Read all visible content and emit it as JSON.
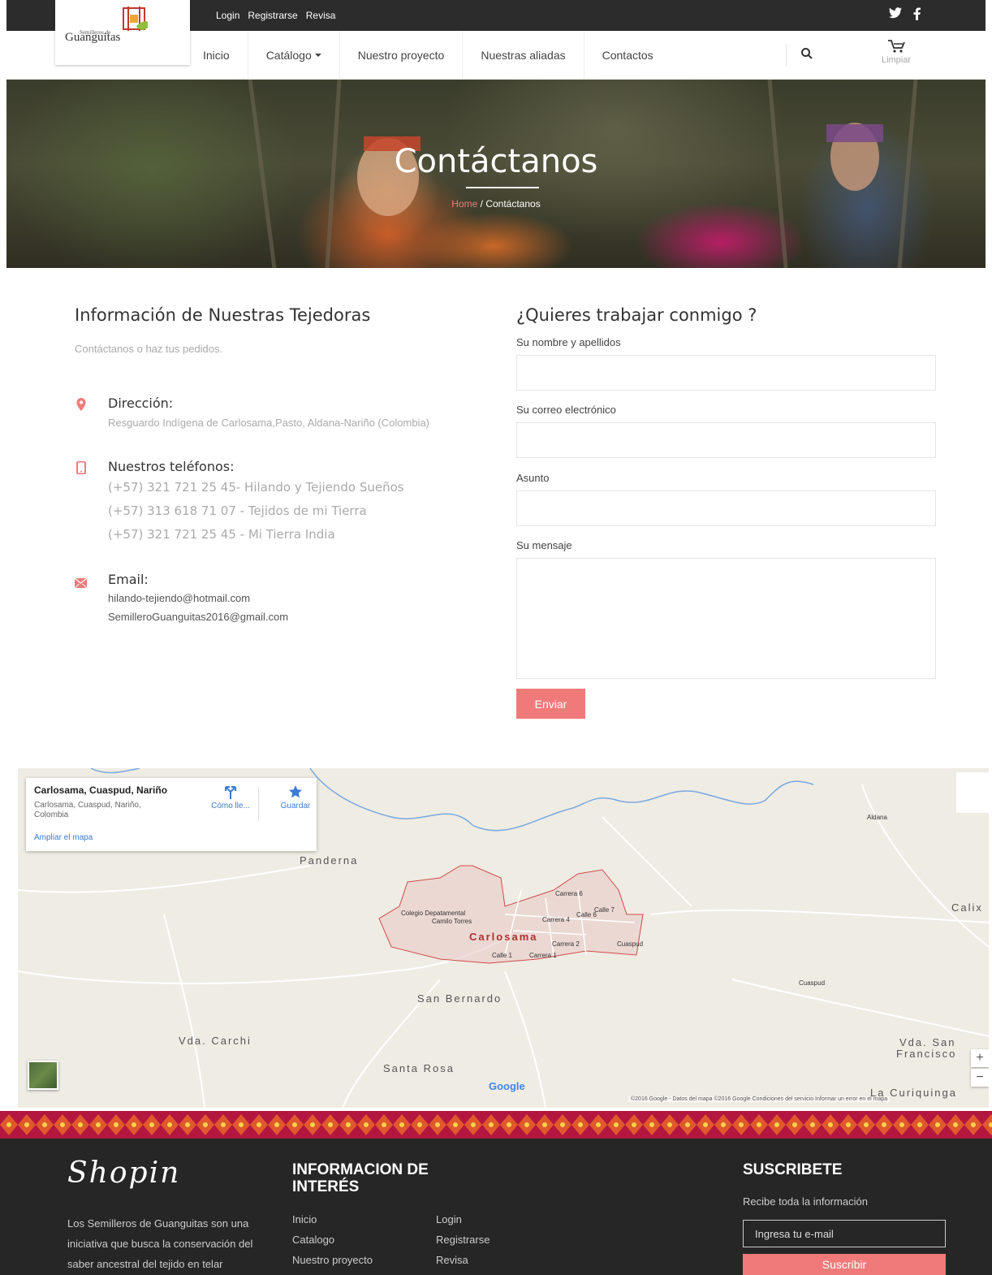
{
  "topbar": {
    "links": [
      "Login",
      "Registrarse",
      "Revisa"
    ],
    "social": [
      "twitter-icon",
      "facebook-icon"
    ]
  },
  "logo": {
    "tagline": "Semilleros de",
    "name": "Guanguitas"
  },
  "nav": {
    "items": [
      "Inicio",
      "Catálogo",
      "Nuestro proyecto",
      "Nuestras aliadas",
      "Contactos"
    ],
    "cart_label": "Limpiar"
  },
  "hero": {
    "title": "Contáctanos",
    "crumb_home": "Home",
    "crumb_sep": "/",
    "crumb_current": "Contáctanos"
  },
  "info": {
    "title": "Información de Nuestras Tejedoras",
    "subtitle": "Contáctanos o haz tus pedidos.",
    "address_head": "Dirección:",
    "address": "Resguardo Indígena de Carlosama,Pasto, Aldana-Nariño (Colombia)",
    "phones_head": "Nuestros teléfonos:",
    "phones": [
      "(+57) 321 721 25 45- Hilando y Tejiendo Sueños",
      "(+57) 313 618 71 07 - Tejidos de mi Tierra",
      "(+57) 321 721 25 45 - Mi Tierra India"
    ],
    "email_head": "Email:",
    "emails": [
      "hilando-tejiendo@hotmail.com",
      "SemilleroGuanguitas2016@gmail.com"
    ]
  },
  "form": {
    "title": "¿Quieres trabajar conmigo ?",
    "name_label": "Su nombre y apellidos",
    "email_label": "Su correo electrónico",
    "subject_label": "Asunto",
    "message_label": "Su mensaje",
    "submit": "Enviar"
  },
  "map": {
    "place_title": "Carlosama, Cuaspud, Nariño",
    "place_address": "Carlosama, Cuaspud, Nariño, Colombia",
    "directions": "Cómo lle...",
    "save": "Guardar",
    "enlarge": "Ampliar el mapa",
    "town": "Carlosama",
    "labels": [
      "Panderna",
      "San Bernardo",
      "Vda. Carchi",
      "Santa Rosa",
      "Calix",
      "Vda. San",
      "Francisco",
      "La Curiquinga"
    ],
    "streets": [
      "Colegio Depatamental",
      "Camilo Torres",
      "Carrera 6",
      "Carrera 4",
      "Calle 6",
      "Calle 7",
      "Carrera 2",
      "Carrera 1",
      "Calle 1",
      "Cuaspud",
      "Cuaspud",
      "Aldana"
    ],
    "google": "Google",
    "footer": "©2016 Google - Datos del mapa ©2016 Google   Condiciones del servicio   Informar un error en el mapa",
    "zoom_in": "+",
    "zoom_out": "−"
  },
  "footer": {
    "brand": "Shopin",
    "description": "Los Semilleros de Guanguitas son una iniciativa que busca la conservación del saber ancestral del tejido en telar",
    "info_title_1": "INFORMACION DE",
    "info_title_2": "INTERÉS",
    "col1": [
      "Inicio",
      "Catalogo",
      "Nuestro proyecto"
    ],
    "col2": [
      "Login",
      "Registrarse",
      "Revisa"
    ],
    "subscribe_title": "SUSCRIBETE",
    "subscribe_info": "Recibe toda la información",
    "email_placeholder": "Ingresa tu e-mail",
    "subscribe_button": "Suscribir"
  },
  "colors": {
    "accent": "#f07a7a",
    "topbar": "#2c2c2c",
    "footer": "#262626",
    "band": "#b3163f"
  }
}
